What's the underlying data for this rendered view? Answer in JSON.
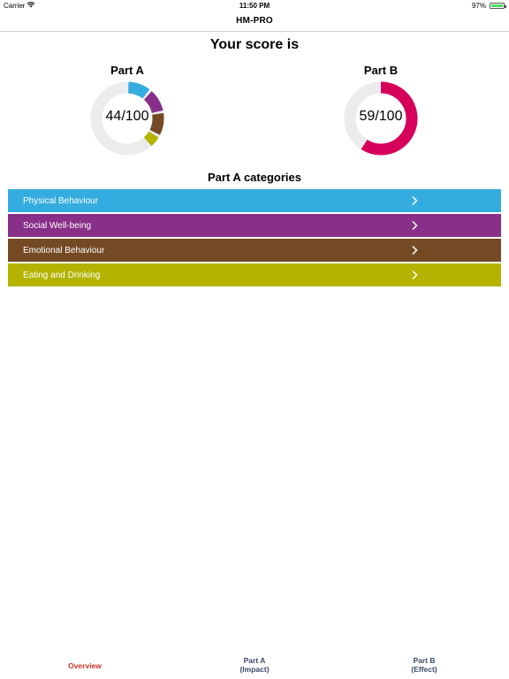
{
  "status_bar": {
    "carrier": "Carrier",
    "time": "11:50 PM",
    "battery": "97%",
    "battery_level": 0.97
  },
  "nav": {
    "title": "HM-PRO"
  },
  "score": {
    "heading": "Your score is",
    "part_a": {
      "label": "Part A",
      "value": "44/100",
      "track_color": "#ececec",
      "segments": [
        {
          "category": "Physical Behaviour",
          "color": "#34ace0",
          "fraction": 0.11
        },
        {
          "category": "Social Well-being",
          "color": "#872f89",
          "fraction": 0.11
        },
        {
          "category": "Emotional Behaviour",
          "color": "#744a25",
          "fraction": 0.11
        },
        {
          "category": "Eating and Drinking",
          "color": "#b3b300",
          "fraction": 0.06
        }
      ]
    },
    "part_b": {
      "label": "Part B",
      "value": "59/100",
      "track_color": "#ececec",
      "color": "#d6005a",
      "fraction": 0.59
    }
  },
  "categories": {
    "heading": "Part A categories",
    "items": [
      {
        "label": "Physical Behaviour",
        "color": "#34ace0"
      },
      {
        "label": "Social Well-being",
        "color": "#872f89"
      },
      {
        "label": "Emotional Behaviour",
        "color": "#744a25"
      },
      {
        "label": "Eating and Drinking",
        "color": "#b3b300"
      }
    ]
  },
  "tabs": [
    {
      "lines": [
        "Overview"
      ],
      "active": true
    },
    {
      "lines": [
        "Part A",
        "(Impact)"
      ],
      "active": false
    },
    {
      "lines": [
        "Part B",
        "(Effect)"
      ],
      "active": false
    }
  ],
  "icons": {
    "wifi": "wifi-icon",
    "battery": "battery-icon",
    "chevron": "chevron-right-icon"
  }
}
